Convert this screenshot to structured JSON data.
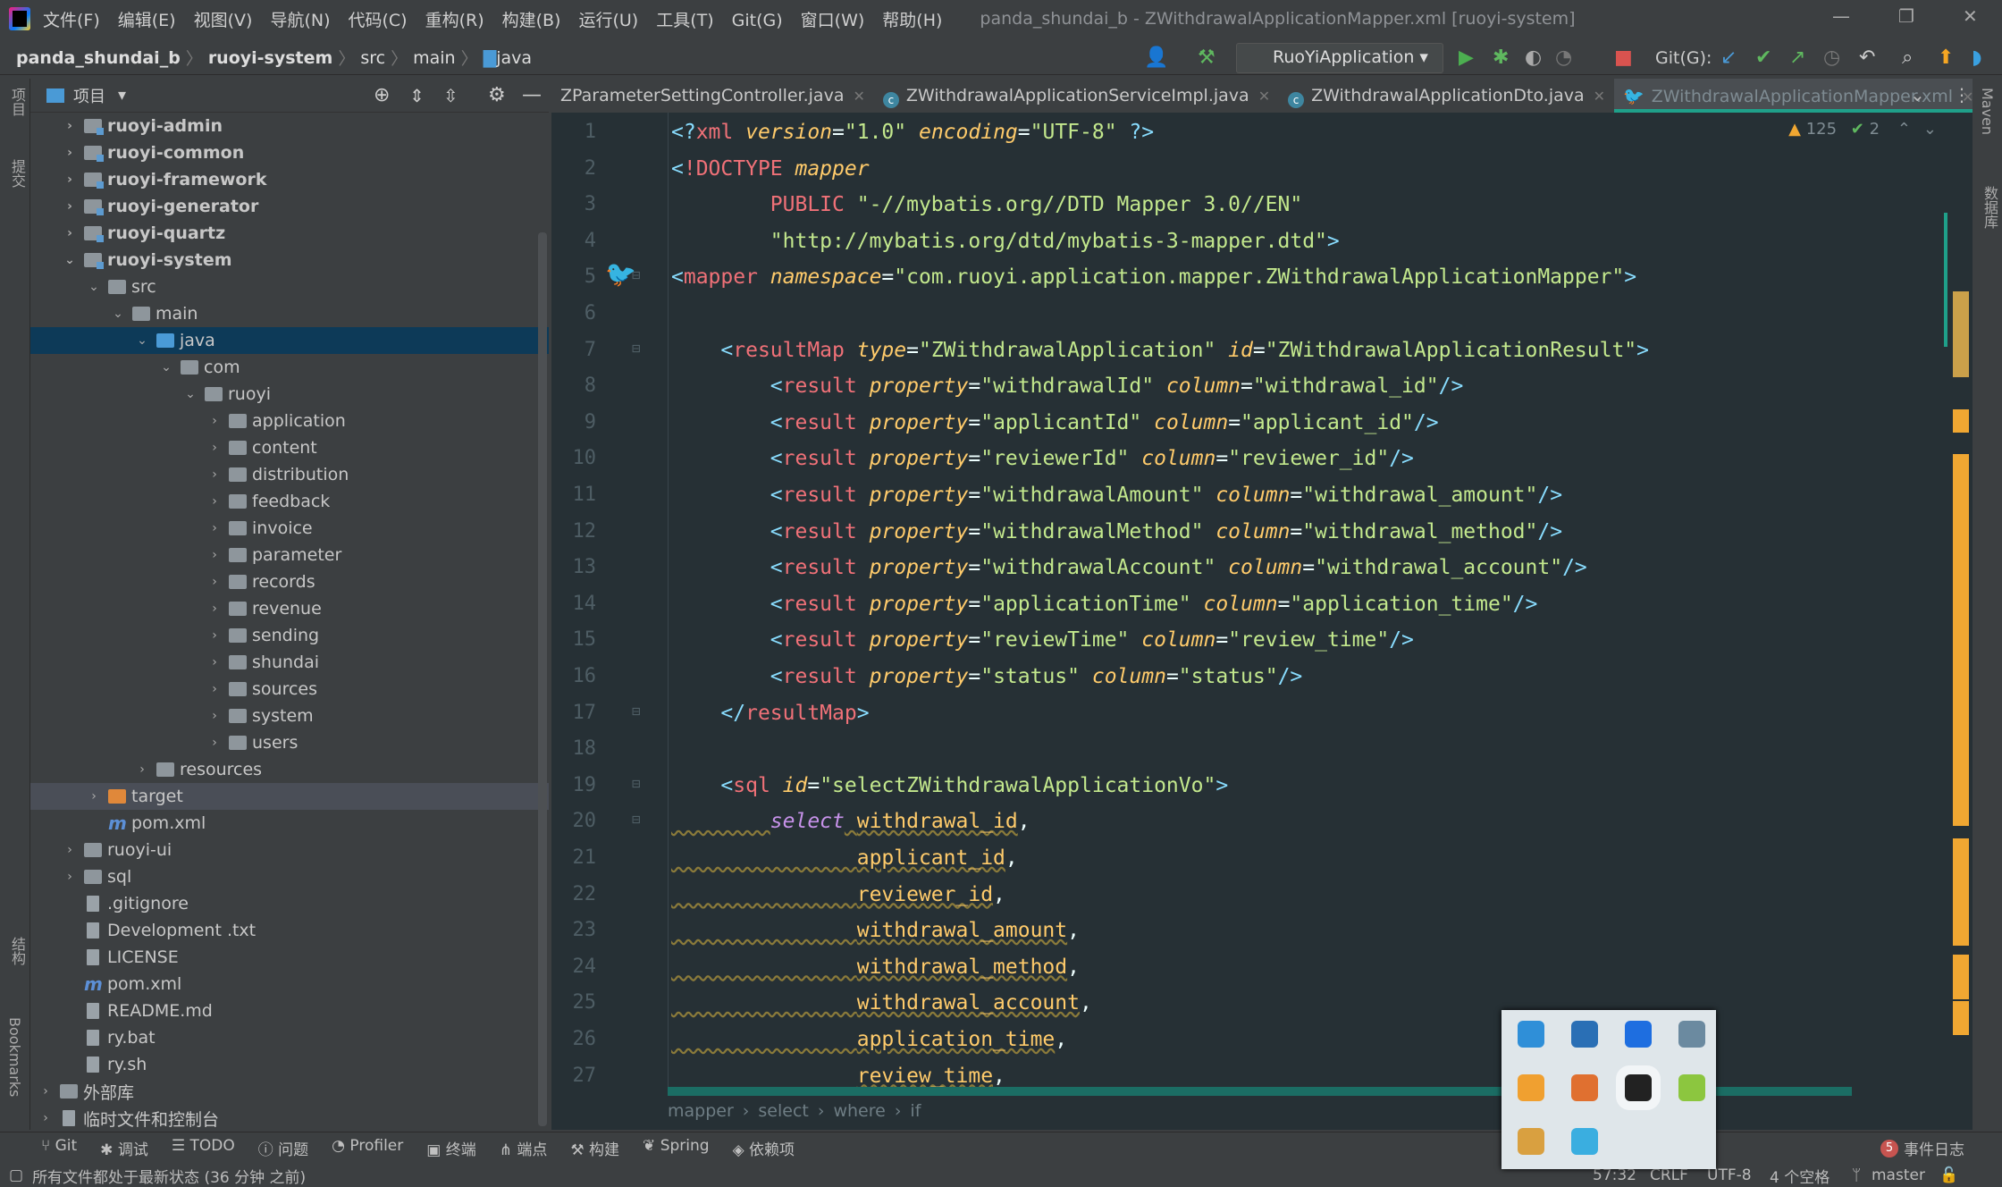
{
  "titlebar": {
    "menu": [
      "文件(F)",
      "编辑(E)",
      "视图(V)",
      "导航(N)",
      "代码(C)",
      "重构(R)",
      "构建(B)",
      "运行(U)",
      "工具(T)",
      "Git(G)",
      "窗口(W)",
      "帮助(H)"
    ],
    "title": "panda_shundai_b - ZWithdrawalApplicationMapper.xml [ruoyi-system]"
  },
  "navbar": {
    "crumbs": [
      "panda_shundai_b",
      "ruoyi-system",
      "src",
      "main",
      "java"
    ],
    "run_config": "RuoYiApplication",
    "git_label": "Git(G):"
  },
  "left_strip": [
    "项目",
    "提交",
    "结构",
    "Bookmarks"
  ],
  "right_strip": [
    "Maven",
    "数据库"
  ],
  "project": {
    "header": "项目",
    "tree": [
      {
        "d": 0,
        "label": "ruoyi-admin",
        "icon": "module",
        "arrow": "right",
        "bold": true
      },
      {
        "d": 0,
        "label": "ruoyi-common",
        "icon": "module",
        "arrow": "right",
        "bold": true
      },
      {
        "d": 0,
        "label": "ruoyi-framework",
        "icon": "module",
        "arrow": "right",
        "bold": true
      },
      {
        "d": 0,
        "label": "ruoyi-generator",
        "icon": "module",
        "arrow": "right",
        "bold": true
      },
      {
        "d": 0,
        "label": "ruoyi-quartz",
        "icon": "module",
        "arrow": "right",
        "bold": true
      },
      {
        "d": 0,
        "label": "ruoyi-system",
        "icon": "module",
        "arrow": "down",
        "bold": true
      },
      {
        "d": 1,
        "label": "src",
        "icon": "folder",
        "arrow": "down"
      },
      {
        "d": 2,
        "label": "main",
        "icon": "folder",
        "arrow": "down"
      },
      {
        "d": 3,
        "label": "java",
        "icon": "blue",
        "arrow": "down",
        "selected": true
      },
      {
        "d": 4,
        "label": "com",
        "icon": "folder",
        "arrow": "down"
      },
      {
        "d": 5,
        "label": "ruoyi",
        "icon": "folder",
        "arrow": "down"
      },
      {
        "d": 6,
        "label": "application",
        "icon": "folder",
        "arrow": "right"
      },
      {
        "d": 6,
        "label": "content",
        "icon": "folder",
        "arrow": "right"
      },
      {
        "d": 6,
        "label": "distribution",
        "icon": "folder",
        "arrow": "right"
      },
      {
        "d": 6,
        "label": "feedback",
        "icon": "folder",
        "arrow": "right"
      },
      {
        "d": 6,
        "label": "invoice",
        "icon": "folder",
        "arrow": "right"
      },
      {
        "d": 6,
        "label": "parameter",
        "icon": "folder",
        "arrow": "right"
      },
      {
        "d": 6,
        "label": "records",
        "icon": "folder",
        "arrow": "right"
      },
      {
        "d": 6,
        "label": "revenue",
        "icon": "folder",
        "arrow": "right"
      },
      {
        "d": 6,
        "label": "sending",
        "icon": "folder",
        "arrow": "right"
      },
      {
        "d": 6,
        "label": "shundai",
        "icon": "folder",
        "arrow": "right"
      },
      {
        "d": 6,
        "label": "sources",
        "icon": "folder",
        "arrow": "right"
      },
      {
        "d": 6,
        "label": "system",
        "icon": "folder",
        "arrow": "right"
      },
      {
        "d": 6,
        "label": "users",
        "icon": "folder",
        "arrow": "right"
      },
      {
        "d": 3,
        "label": "resources",
        "icon": "folder",
        "arrow": "right"
      },
      {
        "d": 1,
        "label": "target",
        "icon": "orange",
        "arrow": "right",
        "highlight": true
      },
      {
        "d": 1,
        "label": "pom.xml",
        "icon": "maven"
      },
      {
        "d": 0,
        "label": "ruoyi-ui",
        "icon": "folder",
        "arrow": "right"
      },
      {
        "d": 0,
        "label": "sql",
        "icon": "folder",
        "arrow": "right"
      },
      {
        "d": 0,
        "label": ".gitignore",
        "icon": "file"
      },
      {
        "d": 0,
        "label": "Development .txt",
        "icon": "file"
      },
      {
        "d": 0,
        "label": "LICENSE",
        "icon": "file"
      },
      {
        "d": 0,
        "label": "pom.xml",
        "icon": "maven"
      },
      {
        "d": 0,
        "label": "README.md",
        "icon": "file"
      },
      {
        "d": 0,
        "label": "ry.bat",
        "icon": "file"
      },
      {
        "d": 0,
        "label": "ry.sh",
        "icon": "file"
      },
      {
        "d": -1,
        "label": "外部库",
        "icon": "library",
        "arrow": "right"
      },
      {
        "d": -1,
        "label": "临时文件和控制台",
        "icon": "file",
        "arrow": "right"
      }
    ]
  },
  "editor": {
    "tabs": [
      {
        "label": "ZParameterSettingController.java",
        "icon": "none"
      },
      {
        "label": "ZWithdrawalApplicationServiceImpl.java",
        "icon": "class"
      },
      {
        "label": "ZWithdrawalApplicationDto.java",
        "icon": "class"
      },
      {
        "label": "ZWithdrawalApplicationMapper.xml",
        "icon": "mybatis",
        "active": true
      }
    ],
    "inspections": {
      "warnings": "125",
      "ok": "2"
    },
    "lines": [
      [
        [
          "p",
          "<?"
        ],
        [
          "t",
          "xml "
        ],
        [
          "a",
          "version"
        ],
        [
          "o",
          "="
        ],
        [
          "s",
          "\"1.0\" "
        ],
        [
          "a",
          "encoding"
        ],
        [
          "o",
          "="
        ],
        [
          "s",
          "\"UTF-8\" "
        ],
        [
          "p",
          "?>"
        ]
      ],
      [
        [
          "p",
          "<"
        ],
        [
          "t",
          "!DOCTYPE "
        ],
        [
          "a",
          "mapper"
        ]
      ],
      [
        [
          "o",
          "        "
        ],
        [
          "t",
          "PUBLIC "
        ],
        [
          "s",
          "\"-//mybatis.org//DTD Mapper 3.0//EN\""
        ]
      ],
      [
        [
          "o",
          "        "
        ],
        [
          "s",
          "\"http://mybatis.org/dtd/mybatis-3-mapper.dtd\""
        ],
        [
          "p",
          ">"
        ]
      ],
      [
        [
          "p",
          "<"
        ],
        [
          "t",
          "mapper "
        ],
        [
          "a",
          "namespace"
        ],
        [
          "o",
          "="
        ],
        [
          "s",
          "\"com.ruoyi.application.mapper.ZWithdrawalApplicationMapper\""
        ],
        [
          "p",
          ">"
        ]
      ],
      [],
      [
        [
          "o",
          "    "
        ],
        [
          "p",
          "<"
        ],
        [
          "t",
          "resultMap "
        ],
        [
          "a",
          "type"
        ],
        [
          "o",
          "="
        ],
        [
          "s",
          "\"ZWithdrawalApplication\" "
        ],
        [
          "a",
          "id"
        ],
        [
          "o",
          "="
        ],
        [
          "s",
          "\"ZWithdrawalApplicationResult\""
        ],
        [
          "p",
          ">"
        ]
      ],
      [
        [
          "o",
          "        "
        ],
        [
          "p",
          "<"
        ],
        [
          "t",
          "result "
        ],
        [
          "a",
          "property"
        ],
        [
          "o",
          "="
        ],
        [
          "s",
          "\"withdrawalId\" "
        ],
        [
          "a",
          "column"
        ],
        [
          "o",
          "="
        ],
        [
          "s",
          "\"withdrawal_id\""
        ],
        [
          "p",
          "/>"
        ]
      ],
      [
        [
          "o",
          "        "
        ],
        [
          "p",
          "<"
        ],
        [
          "t",
          "result "
        ],
        [
          "a",
          "property"
        ],
        [
          "o",
          "="
        ],
        [
          "s",
          "\"applicantId\" "
        ],
        [
          "a",
          "column"
        ],
        [
          "o",
          "="
        ],
        [
          "s",
          "\"applicant_id\""
        ],
        [
          "p",
          "/>"
        ]
      ],
      [
        [
          "o",
          "        "
        ],
        [
          "p",
          "<"
        ],
        [
          "t",
          "result "
        ],
        [
          "a",
          "property"
        ],
        [
          "o",
          "="
        ],
        [
          "s",
          "\"reviewerId\" "
        ],
        [
          "a",
          "column"
        ],
        [
          "o",
          "="
        ],
        [
          "s",
          "\"reviewer_id\""
        ],
        [
          "p",
          "/>"
        ]
      ],
      [
        [
          "o",
          "        "
        ],
        [
          "p",
          "<"
        ],
        [
          "t",
          "result "
        ],
        [
          "a",
          "property"
        ],
        [
          "o",
          "="
        ],
        [
          "s",
          "\"withdrawalAmount\" "
        ],
        [
          "a",
          "column"
        ],
        [
          "o",
          "="
        ],
        [
          "s",
          "\"withdrawal_amount\""
        ],
        [
          "p",
          "/>"
        ]
      ],
      [
        [
          "o",
          "        "
        ],
        [
          "p",
          "<"
        ],
        [
          "t",
          "result "
        ],
        [
          "a",
          "property"
        ],
        [
          "o",
          "="
        ],
        [
          "s",
          "\"withdrawalMethod\" "
        ],
        [
          "a",
          "column"
        ],
        [
          "o",
          "="
        ],
        [
          "s",
          "\"withdrawal_method\""
        ],
        [
          "p",
          "/>"
        ]
      ],
      [
        [
          "o",
          "        "
        ],
        [
          "p",
          "<"
        ],
        [
          "t",
          "result "
        ],
        [
          "a",
          "property"
        ],
        [
          "o",
          "="
        ],
        [
          "s",
          "\"withdrawalAccount\" "
        ],
        [
          "a",
          "column"
        ],
        [
          "o",
          "="
        ],
        [
          "s",
          "\"withdrawal_account\""
        ],
        [
          "p",
          "/>"
        ]
      ],
      [
        [
          "o",
          "        "
        ],
        [
          "p",
          "<"
        ],
        [
          "t",
          "result "
        ],
        [
          "a",
          "property"
        ],
        [
          "o",
          "="
        ],
        [
          "s",
          "\"applicationTime\" "
        ],
        [
          "a",
          "column"
        ],
        [
          "o",
          "="
        ],
        [
          "s",
          "\"application_time\""
        ],
        [
          "p",
          "/>"
        ]
      ],
      [
        [
          "o",
          "        "
        ],
        [
          "p",
          "<"
        ],
        [
          "t",
          "result "
        ],
        [
          "a",
          "property"
        ],
        [
          "o",
          "="
        ],
        [
          "s",
          "\"reviewTime\" "
        ],
        [
          "a",
          "column"
        ],
        [
          "o",
          "="
        ],
        [
          "s",
          "\"review_time\""
        ],
        [
          "p",
          "/>"
        ]
      ],
      [
        [
          "o",
          "        "
        ],
        [
          "p",
          "<"
        ],
        [
          "t",
          "result "
        ],
        [
          "a",
          "property"
        ],
        [
          "o",
          "="
        ],
        [
          "s",
          "\"status\" "
        ],
        [
          "a",
          "column"
        ],
        [
          "o",
          "="
        ],
        [
          "s",
          "\"status\""
        ],
        [
          "p",
          "/>"
        ]
      ],
      [
        [
          "o",
          "    "
        ],
        [
          "p",
          "</"
        ],
        [
          "t",
          "resultMap"
        ],
        [
          "p",
          ">"
        ]
      ],
      [],
      [
        [
          "o",
          "    "
        ],
        [
          "p",
          "<"
        ],
        [
          "t",
          "sql "
        ],
        [
          "a",
          "id"
        ],
        [
          "o",
          "="
        ],
        [
          "s",
          "\"selectZWithdrawalApplicationVo\""
        ],
        [
          "p",
          ">"
        ]
      ],
      [
        [
          "sq",
          "        "
        ],
        [
          "k",
          "select"
        ],
        [
          "sq",
          " "
        ],
        [
          "c",
          "withdrawal_id"
        ],
        [
          "o",
          ","
        ]
      ],
      [
        [
          "sq",
          "               "
        ],
        [
          "c",
          "applicant_id"
        ],
        [
          "o",
          ","
        ]
      ],
      [
        [
          "sq",
          "               "
        ],
        [
          "c",
          "reviewer_id"
        ],
        [
          "o",
          ","
        ]
      ],
      [
        [
          "sq",
          "               "
        ],
        [
          "c",
          "withdrawal_amount"
        ],
        [
          "o",
          ","
        ]
      ],
      [
        [
          "sq",
          "               "
        ],
        [
          "c",
          "withdrawal_method"
        ],
        [
          "o",
          ","
        ]
      ],
      [
        [
          "sq",
          "               "
        ],
        [
          "c",
          "withdrawal_account"
        ],
        [
          "o",
          ","
        ]
      ],
      [
        [
          "sq",
          "               "
        ],
        [
          "c",
          "application_time"
        ],
        [
          "o",
          ","
        ]
      ],
      [
        [
          "o",
          "               "
        ],
        [
          "c",
          "review_time"
        ],
        [
          "o",
          ","
        ]
      ]
    ],
    "breadcrumb": [
      "mapper",
      "select",
      "where",
      "if"
    ]
  },
  "toolwindows": [
    "Git",
    "调试",
    "TODO",
    "问题",
    "Profiler",
    "终端",
    "端点",
    "构建",
    "Spring",
    "依赖项"
  ],
  "event_log": {
    "label": "事件日志",
    "count": "5"
  },
  "status": {
    "message": "所有文件都处于最新状态 (36 分钟 之前)",
    "position": "57:32",
    "line_sep": "CRLF",
    "encoding": "UTF-8",
    "indent": "4 个空格",
    "branch": "master"
  },
  "tray_icons": [
    "display-icon",
    "onedrive-icon",
    "bluetooth-icon",
    "network-icon",
    "shield-icon",
    "calendar-icon",
    "app-icon",
    "chrome-icon",
    "usb-icon",
    "browser-icon"
  ]
}
